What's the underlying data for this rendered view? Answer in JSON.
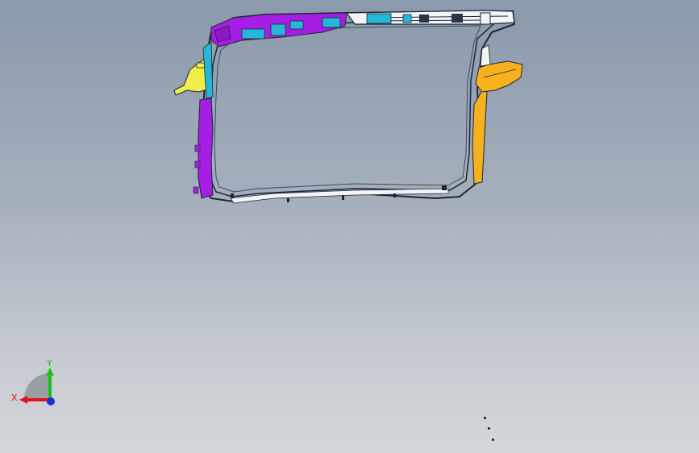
{
  "viewport": {
    "background_top": "#8a99ab",
    "background_bottom": "#d4d7da"
  },
  "model": {
    "icon": "radiator-frame-model",
    "colors": {
      "purple": "#a61ee6",
      "cyan": "#25b6d8",
      "yellow": "#f2ee4a",
      "orange": "#f5b21e",
      "outline": "#1c2634",
      "white": "#f2f4f6"
    }
  },
  "triad": {
    "x_label": "X",
    "y_label": "Y",
    "x_color": "#e0141e",
    "y_color": "#19c219",
    "z_color": "#1a2fd6"
  }
}
